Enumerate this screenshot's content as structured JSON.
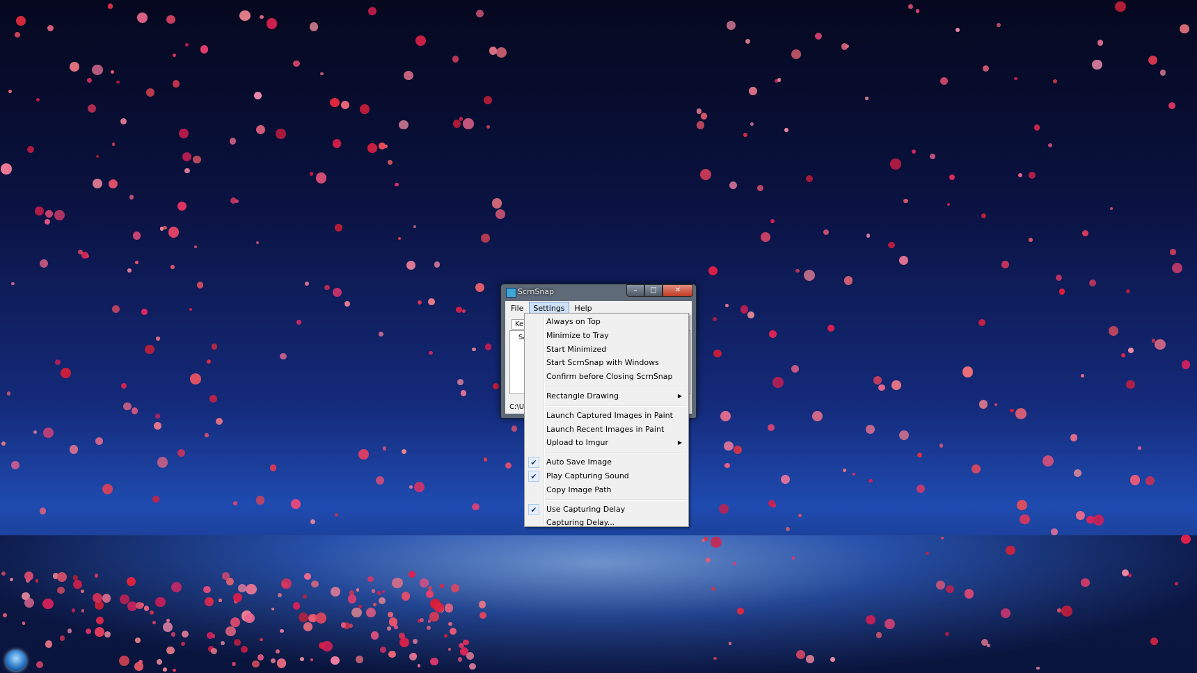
{
  "window": {
    "title": "ScrnSnap",
    "icon": "app-icon",
    "caption_min": "minimize-icon",
    "caption_max": "maximize-icon",
    "caption_close": "close-icon"
  },
  "menubar": {
    "items": [
      {
        "label": "File"
      },
      {
        "label": "Settings",
        "active": true
      },
      {
        "label": "Help"
      }
    ]
  },
  "client": {
    "tab_label": "Key",
    "list_text": "Sa",
    "path_text": "C:\\Use"
  },
  "settings_menu": {
    "groups": [
      [
        {
          "label": "Always on Top",
          "checked": false
        },
        {
          "label": "Minimize to Tray",
          "checked": false
        },
        {
          "label": "Start Minimized",
          "checked": false
        },
        {
          "label": "Start ScrnSnap with Windows",
          "checked": false
        },
        {
          "label": "Confirm before Closing ScrnSnap",
          "checked": false
        }
      ],
      [
        {
          "label": "Rectangle Drawing",
          "submenu": true
        }
      ],
      [
        {
          "label": "Launch Captured Images in Paint",
          "checked": false
        },
        {
          "label": "Launch Recent Images in Paint",
          "checked": false
        },
        {
          "label": "Upload to Imgur",
          "submenu": true
        }
      ],
      [
        {
          "label": "Auto Save Image",
          "checked": true
        },
        {
          "label": "Play Capturing Sound",
          "checked": true
        },
        {
          "label": "Copy Image Path",
          "checked": false
        }
      ],
      [
        {
          "label": "Use Capturing Delay",
          "checked": true
        },
        {
          "label": "Capturing Delay...",
          "checked": false
        }
      ]
    ]
  },
  "colors": {
    "menu_bg": "#f0f0f0",
    "active_menu_bg": "#cde1f7",
    "close_button": "#c23a22"
  },
  "taskbar": {
    "start_button_icon": "windows-start-icon"
  }
}
